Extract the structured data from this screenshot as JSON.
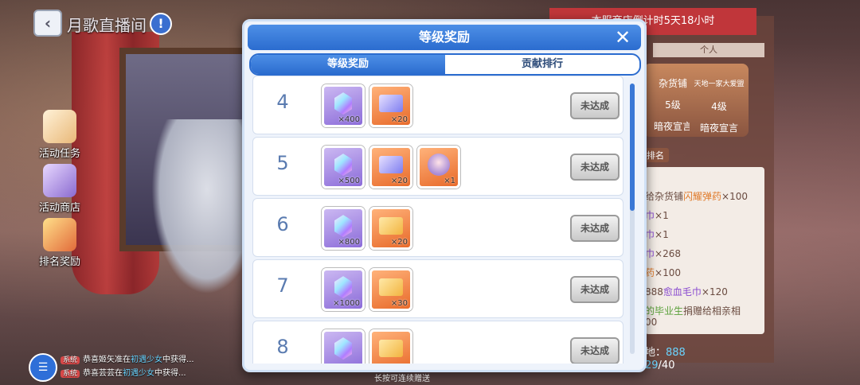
{
  "header": {
    "title": "月歌直播间",
    "back_icon": "‹",
    "info_icon": "!"
  },
  "sidebar": {
    "items": [
      {
        "label": "活动任务",
        "icon": "scroll-icon"
      },
      {
        "label": "活动商店",
        "icon": "shop-icon"
      },
      {
        "label": "排名奖励",
        "icon": "gift-icon"
      }
    ]
  },
  "chat": {
    "lines": [
      {
        "tag": "系统",
        "pre": "恭喜姬矢准在",
        "hl": "初遇少女",
        "post": "中获得..."
      },
      {
        "tag": "系统",
        "pre": "恭喜芸芸在",
        "hl": "初遇少女",
        "post": "中获得..."
      }
    ]
  },
  "right_panel": {
    "banner": "本服商店倒计时5天18小时",
    "tab": "个人",
    "cards": [
      {
        "title": "杂货铺",
        "level": "5级",
        "name": "暗夜宣言"
      },
      {
        "title": "天地一家大爱盟",
        "level": "4级",
        "name": "暗夜宣言"
      }
    ],
    "section_label": "排名",
    "rows": [
      {
        "pre": "给杂货铺",
        "orange": "闪耀弹药",
        "post": "×100"
      },
      {
        "purple": "巾",
        "post": "×1"
      },
      {
        "purple": "巾",
        "post": "×1"
      },
      {
        "purple": "巾",
        "post": "×268"
      },
      {
        "orange": "药",
        "post": "×100"
      },
      {
        "pre": "888",
        "purple": "愈血毛巾",
        "post": "×120"
      },
      {
        "green": "的毕业生",
        "post": "捐赠给相亲相"
      },
      {
        "post": "00"
      }
    ],
    "stat1": {
      "label": "地：",
      "value": "888"
    },
    "stat2": {
      "value": "29",
      "total": "/40"
    }
  },
  "modal": {
    "title": "等级奖励",
    "close_icon": "✕",
    "tabs": [
      {
        "label": "等级奖励",
        "active": true
      },
      {
        "label": "贡献排行",
        "active": false
      }
    ],
    "status_label": "未达成",
    "rows": [
      {
        "level": "4",
        "items": [
          {
            "type": "gem",
            "count": "×400"
          },
          {
            "type": "blue-ticket",
            "count": "×20"
          }
        ]
      },
      {
        "level": "5",
        "items": [
          {
            "type": "gem",
            "count": "×500"
          },
          {
            "type": "blue-ticket",
            "count": "×20"
          },
          {
            "type": "avatar-frame",
            "count": "×1"
          }
        ]
      },
      {
        "level": "6",
        "items": [
          {
            "type": "gem",
            "count": "×800"
          },
          {
            "type": "gold-ticket",
            "count": "×20"
          }
        ]
      },
      {
        "level": "7",
        "items": [
          {
            "type": "gem",
            "count": "×1000"
          },
          {
            "type": "gold-ticket",
            "count": "×30"
          }
        ]
      },
      {
        "level": "8",
        "items": [
          {
            "type": "gem",
            "count": ""
          },
          {
            "type": "gold-ticket",
            "count": ""
          }
        ]
      }
    ]
  },
  "footer_hint": "长按可连续赠送",
  "colors": {
    "primary_blue": "#2b6ccf",
    "accent_red": "#c0363a"
  }
}
